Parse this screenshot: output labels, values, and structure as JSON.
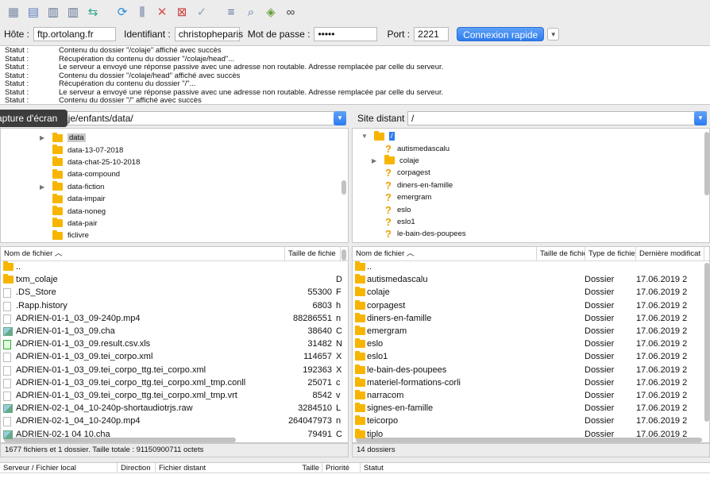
{
  "toolbar": {
    "icons": [
      "site-manager-icon",
      "toggle-log-icon",
      "toggle-local-tree-icon",
      "toggle-remote-tree-icon",
      "toggle-queue-icon",
      "refresh-icon",
      "process-queue-icon",
      "cancel-icon",
      "disconnect-icon",
      "reconnect-icon",
      "filter-icon",
      "search-icon",
      "compare-icon",
      "binoculars-icon"
    ]
  },
  "quickconnect": {
    "host_label": "Hôte :",
    "host_value": "ftp.ortolang.fr",
    "user_label": "Identifiant :",
    "user_value": "christopheparis",
    "pass_label": "Mot de passe :",
    "pass_value": "•••••",
    "port_label": "Port :",
    "port_value": "2221",
    "connect_label": "Connexion rapide"
  },
  "log": [
    {
      "label": "Statut :",
      "msg": "Contenu du dossier \"/colaje\" affiché avec succès"
    },
    {
      "label": "Statut :",
      "msg": "Récupération du contenu du dossier \"/colaje/head\"..."
    },
    {
      "label": "Statut :",
      "msg": "Le serveur a envoyé une réponse passive avec une adresse non routable. Adresse remplacée par celle du serveur."
    },
    {
      "label": "Statut :",
      "msg": "Contenu du dossier \"/colaje/head\" affiché avec succès"
    },
    {
      "label": "Statut :",
      "msg": "Récupération du contenu du dossier \"/\"..."
    },
    {
      "label": "Statut :",
      "msg": "Le serveur a envoyé une réponse passive avec une adresse non routable. Adresse remplacée par celle du serveur."
    },
    {
      "label": "Statut :",
      "msg": "Contenu du dossier \"/\" affiché avec succès"
    }
  ],
  "tooltip": "apture d'écran",
  "local": {
    "path": "aje/enfants/data/",
    "tree": [
      {
        "name": "data",
        "expand": true,
        "selected": true
      },
      {
        "name": "data-13-07-2018",
        "expand": false
      },
      {
        "name": "data-chat-25-10-2018",
        "expand": false
      },
      {
        "name": "data-compound",
        "expand": false
      },
      {
        "name": "data-fiction",
        "expand": true
      },
      {
        "name": "data-impair",
        "expand": false
      },
      {
        "name": "data-noneg",
        "expand": false
      },
      {
        "name": "data-pair",
        "expand": false
      },
      {
        "name": "ficlivre",
        "expand": false
      }
    ],
    "columns": [
      "Nom de fichier",
      "Taille de fichie"
    ],
    "files": [
      {
        "icon": "folder",
        "name": "..",
        "size": "",
        "extra": ""
      },
      {
        "icon": "folder",
        "name": "txm_colaje",
        "size": "",
        "extra": "D"
      },
      {
        "icon": "doc",
        "name": ".DS_Store",
        "size": "55300",
        "extra": "F"
      },
      {
        "icon": "doc",
        "name": ".Rapp.history",
        "size": "6803",
        "extra": "h"
      },
      {
        "icon": "doc",
        "name": "ADRIEN-01-1_03_09-240p.mp4",
        "size": "88286551",
        "extra": "n"
      },
      {
        "icon": "img",
        "name": "ADRIEN-01-1_03_09.cha",
        "size": "38640",
        "extra": "C"
      },
      {
        "icon": "xls",
        "name": "ADRIEN-01-1_03_09.result.csv.xls",
        "size": "31482",
        "extra": "N"
      },
      {
        "icon": "doc",
        "name": "ADRIEN-01-1_03_09.tei_corpo.xml",
        "size": "114657",
        "extra": "X"
      },
      {
        "icon": "doc",
        "name": "ADRIEN-01-1_03_09.tei_corpo_ttg.tei_corpo.xml",
        "size": "192363",
        "extra": "X"
      },
      {
        "icon": "doc",
        "name": "ADRIEN-01-1_03_09.tei_corpo_ttg.tei_corpo.xml_tmp.conll",
        "size": "25071",
        "extra": "c"
      },
      {
        "icon": "doc",
        "name": "ADRIEN-01-1_03_09.tei_corpo_ttg.tei_corpo.xml_tmp.vrt",
        "size": "8542",
        "extra": "v"
      },
      {
        "icon": "img",
        "name": "ADRIEN-02-1_04_10-240p-shortaudiotrjs.raw",
        "size": "3284510",
        "extra": "L"
      },
      {
        "icon": "doc",
        "name": "ADRIEN-02-1_04_10-240p.mp4",
        "size": "264047973",
        "extra": "n"
      },
      {
        "icon": "img",
        "name": "ADRIEN-02-1 04 10.cha",
        "size": "79491",
        "extra": "C"
      }
    ],
    "status": "1677 fichiers et 1 dossier. Taille totale : 91150900711 octets"
  },
  "remote": {
    "label": "Site distant :",
    "path": "/",
    "tree": [
      {
        "name": "/",
        "type": "root"
      },
      {
        "name": "autismedascalu",
        "type": "q"
      },
      {
        "name": "colaje",
        "type": "folder"
      },
      {
        "name": "corpagest",
        "type": "q"
      },
      {
        "name": "diners-en-famille",
        "type": "q"
      },
      {
        "name": "emergram",
        "type": "q"
      },
      {
        "name": "eslo",
        "type": "q"
      },
      {
        "name": "eslo1",
        "type": "q"
      },
      {
        "name": "le-bain-des-poupees",
        "type": "q"
      }
    ],
    "columns": [
      "Nom de fichier",
      "Taille de fichie",
      "Type de fichier",
      "Dernière modificat"
    ],
    "files": [
      {
        "name": "..",
        "type": "",
        "date": ""
      },
      {
        "name": "autismedascalu",
        "type": "Dossier",
        "date": "17.06.2019 2"
      },
      {
        "name": "colaje",
        "type": "Dossier",
        "date": "17.06.2019 2"
      },
      {
        "name": "corpagest",
        "type": "Dossier",
        "date": "17.06.2019 2"
      },
      {
        "name": "diners-en-famille",
        "type": "Dossier",
        "date": "17.06.2019 2"
      },
      {
        "name": "emergram",
        "type": "Dossier",
        "date": "17.06.2019 2"
      },
      {
        "name": "eslo",
        "type": "Dossier",
        "date": "17.06.2019 2"
      },
      {
        "name": "eslo1",
        "type": "Dossier",
        "date": "17.06.2019 2"
      },
      {
        "name": "le-bain-des-poupees",
        "type": "Dossier",
        "date": "17.06.2019 2"
      },
      {
        "name": "materiel-formations-corli",
        "type": "Dossier",
        "date": "17.06.2019 2"
      },
      {
        "name": "narracom",
        "type": "Dossier",
        "date": "17.06.2019 2"
      },
      {
        "name": "signes-en-famille",
        "type": "Dossier",
        "date": "17.06.2019 2"
      },
      {
        "name": "teicorpo",
        "type": "Dossier",
        "date": "17.06.2019 2"
      },
      {
        "name": "tiplo",
        "type": "Dossier",
        "date": "17.06.2019 2"
      }
    ],
    "status": "14 dossiers"
  },
  "queue": {
    "columns": [
      "Serveur / Fichier local",
      "Direction",
      "Fichier distant",
      "Taille",
      "Priorité",
      "Statut"
    ]
  }
}
